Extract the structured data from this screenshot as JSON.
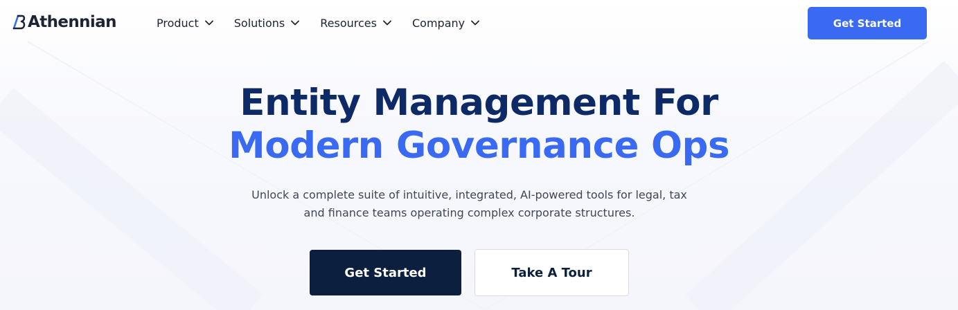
{
  "brand": {
    "name": "Athennian",
    "logo_icon": "athennian-logo-mark"
  },
  "nav": {
    "items": [
      {
        "label": "Product",
        "icon": "chevron-down-icon"
      },
      {
        "label": "Solutions",
        "icon": "chevron-down-icon"
      },
      {
        "label": "Resources",
        "icon": "chevron-down-icon"
      },
      {
        "label": "Company",
        "icon": "chevron-down-icon"
      }
    ],
    "cta_label": "Get Started"
  },
  "hero": {
    "title_line1": "Entity Management For",
    "title_line2": "Modern Governance Ops",
    "subtitle_line1": "Unlock a complete suite of intuitive, integrated, AI-powered tools for legal, tax",
    "subtitle_line2": "and finance teams operating complex corporate structures.",
    "primary_button": "Get Started",
    "secondary_button": "Take A Tour"
  },
  "colors": {
    "accent": "#3a6af1",
    "navy": "#0c1f3f",
    "heading": "#0d2a66",
    "text": "#3f4657",
    "background": "#f5f6fc"
  }
}
